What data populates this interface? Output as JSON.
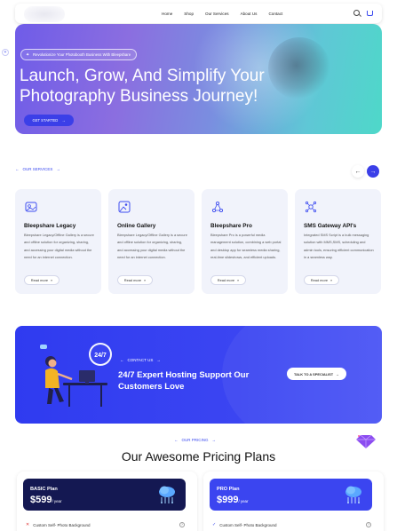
{
  "nav": {
    "menu": [
      "Home",
      "Shop",
      "Our Services",
      "About Us",
      "Contact"
    ],
    "icons": [
      "search-icon",
      "cart-icon"
    ]
  },
  "hero": {
    "badge": "Revolutionize Your Photobooth Business With Bleepshare",
    "title": "Launch, Grow, And Simplify Your Photography Business Journey!",
    "cta": "GET STARTED"
  },
  "services": {
    "label": "OUR SERVICES",
    "prev": "←",
    "next": "→",
    "cards": [
      {
        "icon": "gallery-icon",
        "title": "Bleepshare Legacy",
        "desc": "Bleepshare Legacy/Offline Gallery is a secure and offline solution for organizing, sharing, and accessing your digital media without the need for an internet connection.",
        "more": "Read more"
      },
      {
        "icon": "image-icon",
        "title": "Online Gallery",
        "desc": "Bleepshare Legacy/Offline Gallery is a secure and offline solution for organizing, sharing, and accessing your digital media without the need for an internet connection.",
        "more": "Read more"
      },
      {
        "icon": "network-icon",
        "title": "Bleepshare Pro",
        "desc": "Bleepshare Pro is a powerful media management solution, combining a web portal and desktop app for seamless media sharing, real-time slideshows, and efficient uploads.",
        "more": "Read more"
      },
      {
        "icon": "gateway-icon",
        "title": "SMS Gateway API's",
        "desc": "Integrated SMS Script is a bulk messaging solution with MMS,SMS, scheduling and admin tools, ensuring efficient communication in a seamless way.",
        "more": "Read more"
      }
    ]
  },
  "contact": {
    "label": "CONTACT US",
    "badge": "24/7",
    "title": "24/7 Expert Hosting Support Our Customers Love",
    "cta": "TALK TO A SPECIALIST"
  },
  "pricing": {
    "label": "OUR PRICING",
    "title": "Our Awesome Pricing Plans",
    "plans": [
      {
        "name": "BASIC Plan",
        "price": "$599",
        "per": "/ year",
        "feature": "Custom Self- Photo Background",
        "included": false
      },
      {
        "name": "PRO Plan",
        "price": "$999",
        "per": "/ year",
        "feature": "Custom Self- Photo Background",
        "included": true
      }
    ]
  },
  "colors": {
    "accent": "#3b3fe8",
    "dark_plan": "#141852",
    "card_bg": "#f1f3fb"
  }
}
